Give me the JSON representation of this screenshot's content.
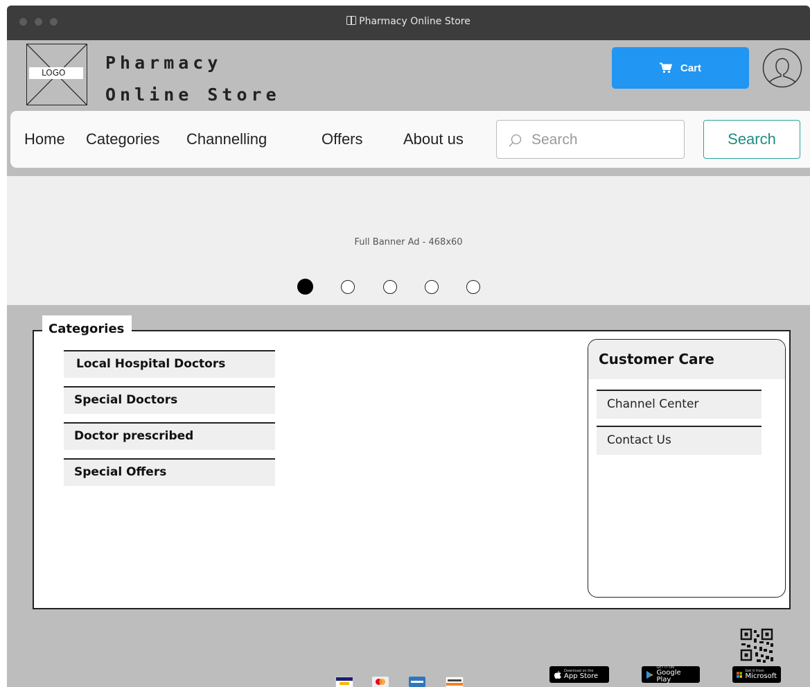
{
  "window": {
    "title": "Pharmacy Online Store"
  },
  "header": {
    "logo_text": "LOGO",
    "brand_line1": "Pharmacy",
    "brand_line2": "Online Store",
    "cart_label": "Cart"
  },
  "nav": {
    "items": [
      "Home",
      "Categories",
      "Channelling",
      "Offers",
      "About us"
    ],
    "search_placeholder": "Search",
    "search_button": "Search"
  },
  "banner": {
    "text": "Full Banner Ad - 468x60",
    "slide_count": 5,
    "active_slide": 1
  },
  "categories": {
    "title": "Categories",
    "items": [
      "Local Hospital Doctors",
      "Special Doctors",
      "Doctor prescribed",
      "Special Offers"
    ]
  },
  "customer_care": {
    "title": "Customer Care",
    "items": [
      "Channel Center",
      "Contact Us"
    ]
  },
  "footer": {
    "app_store": {
      "small": "Download on the",
      "big": "App Store"
    },
    "google_play": {
      "small": "GET IT ON",
      "big": "Google Play"
    },
    "microsoft": {
      "small": "Get it from",
      "big": "Microsoft"
    },
    "payment_icons": [
      "visa-icon",
      "mastercard-icon",
      "amex-icon",
      "discover-icon"
    ]
  },
  "colors": {
    "accent": "#2196f3",
    "search_button_border": "#26a69a",
    "page_background": "#bdbdbd",
    "titlebar": "#3c3c3c"
  }
}
